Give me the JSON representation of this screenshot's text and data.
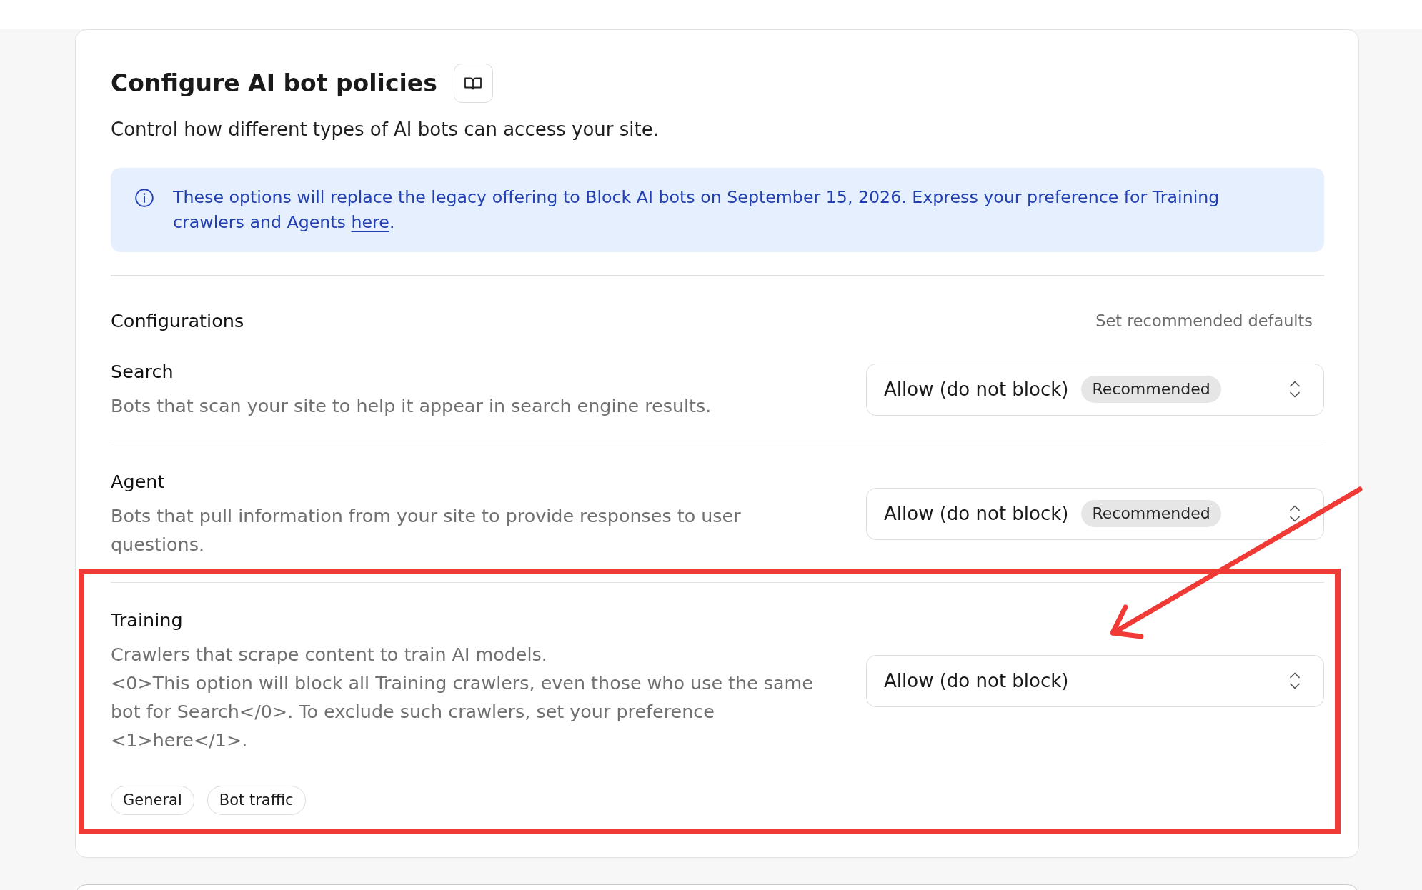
{
  "header": {
    "title": "Configure AI bot policies",
    "subtitle": "Control how different types of AI bots can access your site."
  },
  "notice": {
    "text": "These options will replace the legacy offering to Block AI bots on September 15, 2026. Express your preference for Training crawlers and Agents ",
    "link": "here",
    "text_after": "."
  },
  "configurations": {
    "heading": "Configurations",
    "defaults_button": "Set recommended defaults",
    "policies": [
      {
        "name": "Search",
        "description": "Bots that scan your site to help it appear in search engine results.",
        "select": {
          "value": "Allow (do not block)",
          "badge": "Recommended"
        }
      },
      {
        "name": "Agent",
        "description": "Bots that pull information from your site to provide responses to user questions.",
        "select": {
          "value": "Allow (do not block)",
          "badge": "Recommended"
        }
      },
      {
        "name": "Training",
        "description": "Crawlers that scrape content to train AI models.",
        "note": "<0>This option will block all Training crawlers, even those who use the same bot for Search</0>. To exclude such crawlers, set your preference <1>here</1>.",
        "select": {
          "value": "Allow (do not block)"
        },
        "tags": [
          "General",
          "Bot traffic"
        ]
      }
    ]
  }
}
